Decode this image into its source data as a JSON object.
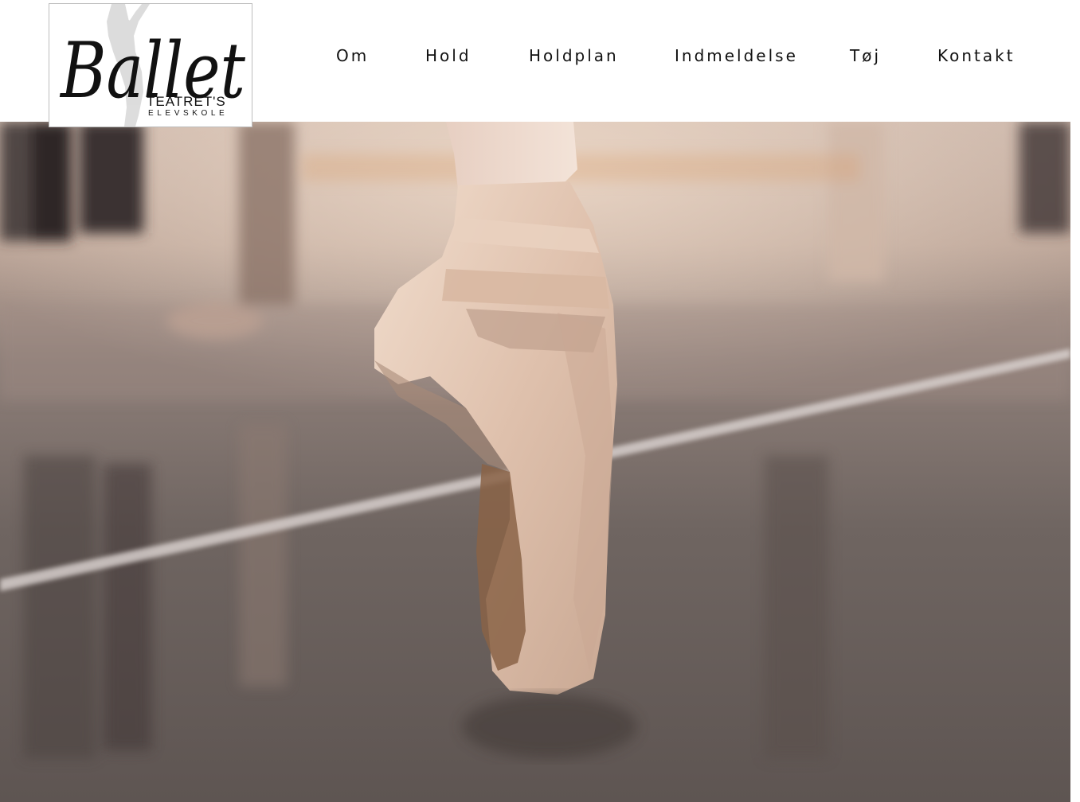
{
  "logo": {
    "wordmark": "Ballet",
    "line1": "TEATRET'S",
    "line2": "ELEVSKOLE"
  },
  "nav": [
    {
      "label": "Om"
    },
    {
      "label": "Hold"
    },
    {
      "label": "Holdplan"
    },
    {
      "label": "Indmeldelse"
    },
    {
      "label": "Tøj"
    },
    {
      "label": "Kontakt"
    }
  ],
  "hero": {
    "image": "pointe-shoe-photo",
    "tone": "#9b8b84"
  }
}
